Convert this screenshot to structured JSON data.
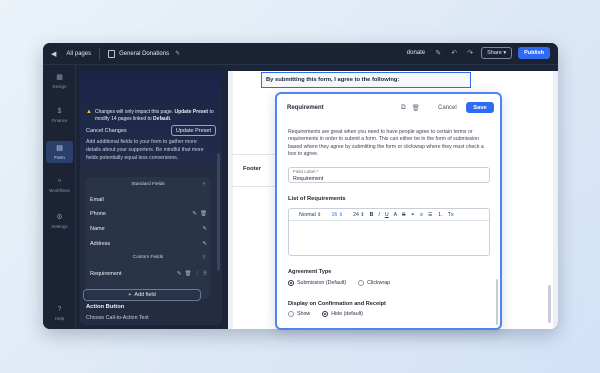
{
  "topbar": {
    "back_icon": "arrow-left-icon",
    "all_pages": "All pages",
    "page_title": "General Donations",
    "slug": "donate",
    "share_label": "Share",
    "publish_label": "Publish"
  },
  "rail": {
    "items": [
      {
        "label": "Design",
        "icon": "grid-icon"
      },
      {
        "label": "Finance",
        "icon": "dollar-icon"
      },
      {
        "label": "Form",
        "icon": "form-icon"
      },
      {
        "label": "Workflows",
        "icon": "branch-icon"
      },
      {
        "label": "Settings",
        "icon": "gear-icon"
      },
      {
        "label": "Help",
        "icon": "help-icon"
      }
    ]
  },
  "panel": {
    "notice_pre": "Changes will only impact this page. ",
    "notice_bold1": "Update Preset",
    "notice_mid": " to modify 14 pages linked to ",
    "notice_bold2": "Default",
    "notice_end": ".",
    "cancel_changes": "Cancel Changes",
    "update_preset": "Update Preset",
    "description": "Add additional fields to your form to gather more details about your supporters. Be mindful that more fields potentially equal less conversions.",
    "standard_fields_header": "Standard Fields",
    "standard_fields": [
      "Email",
      "Phone",
      "Name",
      "Address"
    ],
    "custom_fields_header": "Custom Fields",
    "custom_fields": [
      "Requirement"
    ],
    "add_field": "Add field",
    "action_heading": "Action Button",
    "action_sub": "Choose Call-to-Action Text"
  },
  "canvas": {
    "agree_text": "By submitting this form, I agree to the following:",
    "footer_label": "Footer"
  },
  "modal": {
    "title": "Requirement",
    "cancel": "Cancel",
    "save": "Save",
    "description": "Requirements are great when you need to have people agree to certain terms or requirements in order to submit a form. This can either be in the form of submission based where they agree by submitting the form or clickwrap where they must check a box to agree.",
    "field_label_caption": "Field Label *",
    "field_label_value": "Requirement",
    "list_heading": "List of Requirements",
    "toolbar": {
      "style": "Normal",
      "size1": "16",
      "size2": "24",
      "bold": "B",
      "italic": "I",
      "underline": "U",
      "font_color": "A",
      "strike": "S",
      "link": "🔗",
      "align": "≡",
      "ul": "☰",
      "ol": "⋮",
      "clear": "Tx"
    },
    "agreement_type_heading": "Agreement Type",
    "agreement_options": [
      "Submission (Default)",
      "Clickwrap"
    ],
    "agreement_selected": 0,
    "display_heading": "Display on Confirmation and Receipt",
    "display_options": [
      "Show",
      "Hide (default)"
    ],
    "display_selected": 1
  },
  "colors": {
    "accent": "#2f6bf2",
    "window_bg": "#1c2537",
    "warning": "#f1c232"
  }
}
